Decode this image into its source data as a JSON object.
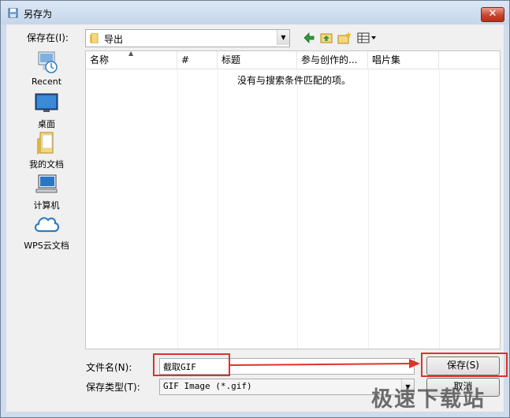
{
  "window": {
    "title": "另存为",
    "close_symbol": "✕"
  },
  "save_in": {
    "label": "保存在(I):",
    "value": "导出"
  },
  "toolbar": {
    "back": "back-icon",
    "up": "up-folder-icon",
    "new_folder": "new-folder-icon",
    "view": "view-menu-icon"
  },
  "places": [
    {
      "label": "Recent",
      "icon": "recent-icon"
    },
    {
      "label": "桌面",
      "icon": "desktop-icon"
    },
    {
      "label": "我的文档",
      "icon": "documents-icon"
    },
    {
      "label": "计算机",
      "icon": "computer-icon"
    },
    {
      "label": "WPS云文档",
      "icon": "cloud-icon"
    }
  ],
  "list": {
    "columns": [
      "名称",
      "#",
      "标题",
      "参与创作的...",
      "唱片集"
    ],
    "empty_text": "没有与搜索条件匹配的项。"
  },
  "filename": {
    "label": "文件名(N):",
    "value": "截取GIF"
  },
  "filetype": {
    "label": "保存类型(T):",
    "value": "GIF Image (*.gif)"
  },
  "buttons": {
    "save": "保存(S)",
    "cancel": "取消"
  },
  "watermark": "极速下载站",
  "colors": {
    "highlight": "#e0312b",
    "title_bar": "#c5d6ea"
  }
}
